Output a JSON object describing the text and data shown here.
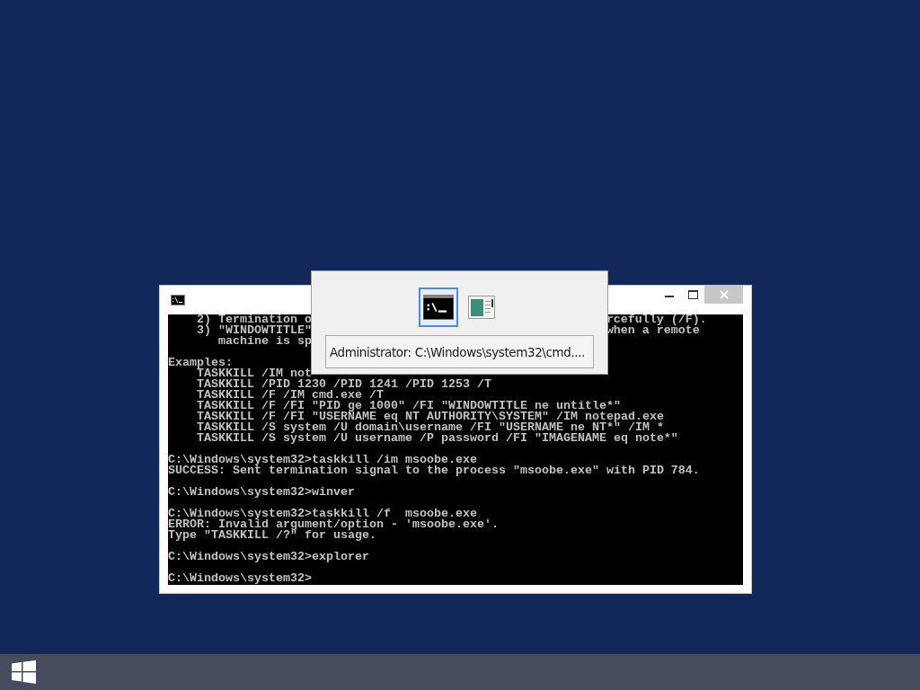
{
  "console_window": {
    "output_blocks": [
      [
        {
          "text": "    2) Termination o",
          "text_right": "rcefully (/F)."
        },
        {
          "text": "    3) \"WINDOWTITLE\"",
          "text_right": "when a remote"
        },
        {
          "text": "       machine is sp"
        }
      ],
      [
        {
          "text": "Examples:"
        },
        {
          "text": "    TASKKILL /IM not"
        },
        {
          "text": "    TASKKILL /PID 1230 /PID 1241 /PID 1253 /T"
        },
        {
          "text": "    TASKKILL /F /IM cmd.exe /T"
        },
        {
          "text": "    TASKKILL /F /FI \"PID ge 1000\" /FI \"WINDOWTITLE ne untitle*\""
        },
        {
          "text": "    TASKKILL /F /FI \"USERNAME eq NT AUTHORITY\\SYSTEM\" /IM notepad.exe"
        },
        {
          "text": "    TASKKILL /S system /U domain\\username /FI \"USERNAME ne NT*\" /IM *"
        },
        {
          "text": "    TASKKILL /S system /U username /P password /FI \"IMAGENAME eq note*\""
        }
      ],
      [
        {
          "text": "C:\\Windows\\system32>taskkill /im msoobe.exe"
        },
        {
          "text": "SUCCESS: Sent termination signal to the process \"msoobe.exe\" with PID 784."
        }
      ],
      [
        {
          "text": "C:\\Windows\\system32>winver"
        }
      ],
      [
        {
          "text": "C:\\Windows\\system32>taskkill /f  msoobe.exe"
        },
        {
          "text": "ERROR: Invalid argument/option - 'msoobe.exe'."
        },
        {
          "text": "Type \"TASKKILL /?\" for usage."
        }
      ],
      [
        {
          "text": "C:\\Windows\\system32>explorer"
        }
      ],
      [
        {
          "text": "C:\\Windows\\system32>"
        }
      ]
    ]
  },
  "task_switcher": {
    "thumbnails": [
      {
        "kind": "console",
        "selected": true
      },
      {
        "kind": "window",
        "selected": false
      }
    ],
    "window_title": "Administrator: C:\\Windows\\system32\\cmd...."
  }
}
